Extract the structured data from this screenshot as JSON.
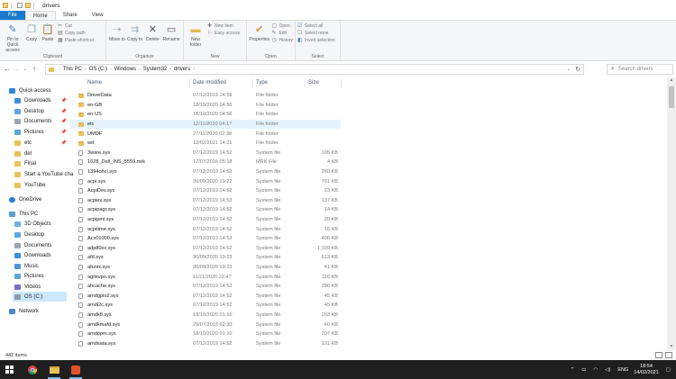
{
  "window": {
    "title": "drivers"
  },
  "ribbon_tabs": [
    "File",
    "Home",
    "Share",
    "View"
  ],
  "ribbon": {
    "clipboard": {
      "label": "Clipboard",
      "pin": "Pin to Quick access",
      "copy": "Copy",
      "paste": "Paste",
      "cut": "Cut",
      "copy_path": "Copy path",
      "paste_shortcut": "Paste shortcut"
    },
    "organize": {
      "label": "Organize",
      "move_to": "Move to",
      "copy_to": "Copy to",
      "delete": "Delete",
      "rename": "Rename"
    },
    "new": {
      "label": "New",
      "new_folder": "New folder",
      "new_item": "New item",
      "easy_access": "Easy access"
    },
    "open": {
      "label": "Open",
      "properties": "Properties",
      "open": "Open",
      "edit": "Edit",
      "history": "History"
    },
    "select": {
      "label": "Select",
      "select_all": "Select all",
      "select_none": "Select none",
      "invert": "Invert selection"
    }
  },
  "address": {
    "crumbs": [
      "This PC",
      "OS (C:)",
      "Windows",
      "System32",
      "drivers"
    ],
    "search_placeholder": "Search drivers"
  },
  "nav": {
    "quick_access": "Quick access",
    "pinned": [
      "Downloads",
      "Desktop",
      "Documents",
      "Pictures",
      "etc"
    ],
    "recent": [
      "del",
      "Final",
      "Start a YouTube cha",
      "YouTube"
    ],
    "onedrive": "OneDrive",
    "this_pc": "This PC",
    "pc_items": [
      "3D Objects",
      "Desktop",
      "Documents",
      "Downloads",
      "Music",
      "Pictures",
      "Videos",
      "OS (C:)"
    ],
    "network": "Network"
  },
  "columns": {
    "name": "Name",
    "date": "Date modified",
    "type": "Type",
    "size": "Size"
  },
  "files": [
    {
      "name": "DriverData",
      "date": "07/12/2019 14:59",
      "type": "File folder",
      "size": "",
      "kind": "folder"
    },
    {
      "name": "en-GB",
      "date": "18/10/2020 04:56",
      "type": "File folder",
      "size": "",
      "kind": "folder"
    },
    {
      "name": "en-US",
      "date": "18/10/2020 04:56",
      "type": "File folder",
      "size": "",
      "kind": "folder"
    },
    {
      "name": "etc",
      "date": "12/11/2020 04:17",
      "type": "File folder",
      "size": "",
      "kind": "folder"
    },
    {
      "name": "UMDF",
      "date": "27/11/2020 02:38",
      "type": "File folder",
      "size": "",
      "kind": "folder"
    },
    {
      "name": "wd",
      "date": "12/02/2021 14:21",
      "type": "File folder",
      "size": "",
      "kind": "folder"
    },
    {
      "name": "3ware.sys",
      "date": "07/12/2019 14:52",
      "type": "System file",
      "size": "105 KB",
      "kind": "file"
    },
    {
      "name": "1028_Dell_INS_5559.mrk",
      "date": "17/07/2016 05:18",
      "type": "MRK File",
      "size": "4 KB",
      "kind": "file"
    },
    {
      "name": "1394ohci.sys",
      "date": "07/12/2019 14:52",
      "type": "System file",
      "size": "260 KB",
      "kind": "file"
    },
    {
      "name": "acpi.sys",
      "date": "30/09/2020 19:22",
      "type": "System file",
      "size": "791 KB",
      "kind": "file"
    },
    {
      "name": "AcpiDev.sys",
      "date": "07/12/2019 14:52",
      "type": "System file",
      "size": "23 KB",
      "kind": "file"
    },
    {
      "name": "acpiex.sys",
      "date": "07/12/2019 14:53",
      "type": "System file",
      "size": "137 KB",
      "kind": "file"
    },
    {
      "name": "acpipagr.sys",
      "date": "07/12/2019 14:52",
      "type": "System file",
      "size": "14 KB",
      "kind": "file"
    },
    {
      "name": "acpipmi.sys",
      "date": "07/12/2019 14:52",
      "type": "System file",
      "size": "20 KB",
      "kind": "file"
    },
    {
      "name": "acpitime.sys",
      "date": "07/12/2019 14:52",
      "type": "System file",
      "size": "16 KB",
      "kind": "file"
    },
    {
      "name": "Acx01000.sys",
      "date": "07/12/2019 14:53",
      "type": "System file",
      "size": "406 KB",
      "kind": "file"
    },
    {
      "name": "adp80xx.sys",
      "date": "07/12/2019 14:52",
      "type": "System file",
      "size": "1,109 KB",
      "kind": "file"
    },
    {
      "name": "afd.sys",
      "date": "30/09/2020 19:23",
      "type": "System file",
      "size": "613 KB",
      "kind": "file"
    },
    {
      "name": "afunix.sys",
      "date": "30/09/2020 19:23",
      "type": "System file",
      "size": "41 KB",
      "kind": "file"
    },
    {
      "name": "agilevpn.sys",
      "date": "11/11/2020 22:47",
      "type": "System file",
      "size": "116 KB",
      "kind": "file"
    },
    {
      "name": "ahcache.sys",
      "date": "07/12/2019 14:53",
      "type": "System file",
      "size": "286 KB",
      "kind": "file"
    },
    {
      "name": "amdgpio2.sys",
      "date": "07/12/2019 14:52",
      "type": "System file",
      "size": "45 KB",
      "kind": "file"
    },
    {
      "name": "amdi2c.sys",
      "date": "07/12/2019 14:52",
      "type": "System file",
      "size": "45 KB",
      "kind": "file"
    },
    {
      "name": "amdk8.sys",
      "date": "18/10/2020 01:10",
      "type": "System file",
      "size": "203 KB",
      "kind": "file"
    },
    {
      "name": "amdkmafd.sys",
      "date": "29/07/2015 02:30",
      "type": "System file",
      "size": "40 KB",
      "kind": "file"
    },
    {
      "name": "amdppm.sys",
      "date": "18/10/2020 01:10",
      "type": "System file",
      "size": "207 KB",
      "kind": "file"
    },
    {
      "name": "amdsata.sys",
      "date": "07/12/2019 14:52",
      "type": "System file",
      "size": "101 KB",
      "kind": "file"
    }
  ],
  "status": {
    "item_count": "442 items"
  },
  "taskbar": {
    "lang": "ENG",
    "time": "18:54",
    "date": "14/02/2021"
  },
  "colors": {
    "accent": "#1979ca",
    "selection": "#cce8ff",
    "hover": "#e5f3ff",
    "folder": "#e8c258",
    "taskbar": "#1f1f1f"
  }
}
